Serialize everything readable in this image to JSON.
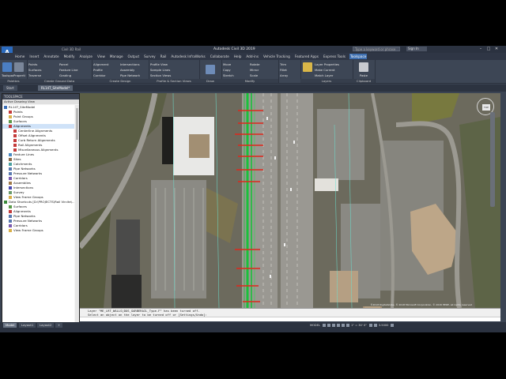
{
  "title_bar": {
    "title": "Autodesk Civil 3D 2019",
    "file": "Civil 3D Rail",
    "search_placeholder": "Type a keyword or phrase",
    "user": "Sign In",
    "window_controls": [
      "–",
      "□",
      "✕"
    ]
  },
  "app_button": "A",
  "menu": [
    "Home",
    "Insert",
    "Annotate",
    "Modify",
    "Analyze",
    "View",
    "Manage",
    "Output",
    "Survey",
    "Rail",
    "Autodesk InfraWorks",
    "Collaborate",
    "Help",
    "Add-ins",
    "Vehicle Tracking",
    "Featured Apps",
    "Express Tools",
    "Toolspace"
  ],
  "active_menu": "Toolspace",
  "ribbon": {
    "groups": [
      {
        "name": "Palettes",
        "items": [
          "Toolspace",
          "Properties"
        ]
      },
      {
        "name": "Create Ground Data",
        "items": [
          "Points",
          "Surfaces",
          "Traverse",
          "Parcel",
          "Feature Line",
          "Grading"
        ]
      },
      {
        "name": "Create Design",
        "items": [
          "Alignment",
          "Profile",
          "Corridor",
          "Intersections",
          "Assembly",
          "Pipe Network"
        ]
      },
      {
        "name": "Profile & Section Views",
        "items": [
          "Profile View",
          "Sample Lines",
          "Section Views"
        ]
      },
      {
        "name": "Draw",
        "items": [
          "Move",
          "Rotate",
          "Copy",
          "Mirror",
          "Stretch",
          "Scale"
        ]
      },
      {
        "name": "Modify",
        "items": [
          "Trim",
          "Fillet",
          "Array"
        ]
      },
      {
        "name": "Layers",
        "items": [
          "Layer Properties",
          "Make Current",
          "Match Layer"
        ]
      },
      {
        "name": "Clipboard",
        "items": [
          "Paste"
        ]
      }
    ]
  },
  "doc_tabs": [
    "Start",
    "RL14T_SiteModel*"
  ],
  "active_doc_tab": "RL14T_SiteModel*",
  "toolspace": {
    "title": "TOOLSPACE",
    "subtitle": "Active Drawing View",
    "tree": [
      {
        "label": "RL14T_SiteModel",
        "level": 0,
        "icon": "drawing-icon"
      },
      {
        "label": "Points",
        "level": 1,
        "icon": "points-icon"
      },
      {
        "label": "Point Groups",
        "level": 1,
        "icon": "folder-icon"
      },
      {
        "label": "Surfaces",
        "level": 1,
        "icon": "surface-icon"
      },
      {
        "label": "Alignments",
        "level": 1,
        "icon": "alignment-icon",
        "selected": true
      },
      {
        "label": "Centerline Alignments",
        "level": 2,
        "icon": "alignment-icon"
      },
      {
        "label": "Offset Alignments",
        "level": 2,
        "icon": "alignment-icon"
      },
      {
        "label": "Curb Return Alignments",
        "level": 2,
        "icon": "alignment-icon"
      },
      {
        "label": "Rail Alignments",
        "level": 2,
        "icon": "alignment-icon"
      },
      {
        "label": "Miscellaneous Alignments",
        "level": 2,
        "icon": "alignment-icon"
      },
      {
        "label": "Feature Lines",
        "level": 1,
        "icon": "feature-icon"
      },
      {
        "label": "Sites",
        "level": 1,
        "icon": "site-icon"
      },
      {
        "label": "Catchments",
        "level": 1,
        "icon": "catchment-icon"
      },
      {
        "label": "Pipe Networks",
        "level": 1,
        "icon": "pipe-icon"
      },
      {
        "label": "Pressure Networks",
        "level": 1,
        "icon": "pipe-icon"
      },
      {
        "label": "Corridors",
        "level": 1,
        "icon": "corridor-icon"
      },
      {
        "label": "Assemblies",
        "level": 1,
        "icon": "assembly-icon"
      },
      {
        "label": "Intersections",
        "level": 1,
        "icon": "intersection-icon"
      },
      {
        "label": "Survey",
        "level": 1,
        "icon": "survey-icon"
      },
      {
        "label": "View Frame Groups",
        "level": 1,
        "icon": "folder-icon"
      },
      {
        "label": "Data Shortcuts [D:\\PROJECTS\\Rail Vircite\\...]",
        "level": 0,
        "icon": "shortcut-icon"
      },
      {
        "label": "Surfaces",
        "level": 1,
        "icon": "surface-icon"
      },
      {
        "label": "Alignments",
        "level": 1,
        "icon": "alignment-icon"
      },
      {
        "label": "Pipe Networks",
        "level": 1,
        "icon": "pipe-icon"
      },
      {
        "label": "Pressure Networks",
        "level": 1,
        "icon": "pipe-icon"
      },
      {
        "label": "Corridors",
        "level": 1,
        "icon": "corridor-icon"
      },
      {
        "label": "View Frame Groups",
        "level": 1,
        "icon": "folder-icon"
      }
    ]
  },
  "drawing": {
    "viewcube_label": "TOP",
    "attribution": "©2018 DigitalGlobe, © 2018 Microsoft Corporation, © 2018 HERE, all rights reserved"
  },
  "command_line": {
    "lines": [
      "Layer \"ME_LRT_WALLS|DOS_GARBERAIL_Type-F\" has been turned off.",
      "Select an object on the layer to be turned off or [Settings/Undo]:"
    ],
    "prompt": ""
  },
  "layout_tabs": [
    "Model",
    "Layout1",
    "Layout2",
    "+"
  ],
  "active_layout": "Model",
  "status": {
    "space": "MODEL",
    "scale": "1\" = 30' 0\"",
    "value": "3.5000"
  },
  "colors": {
    "accent": "#3e6fb0",
    "alignment_red": "#e0261b",
    "corridor_green": "#19c23a"
  }
}
